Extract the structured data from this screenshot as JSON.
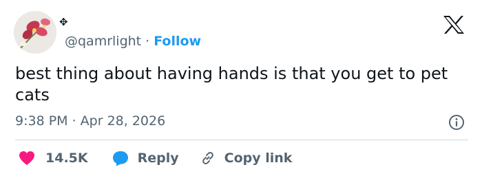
{
  "header": {
    "name_glyph": "✥",
    "handle": "@qamrlight",
    "separator": "·",
    "follow_label": "Follow"
  },
  "tweet": {
    "text": "best thing about having hands is that you get to pet cats",
    "timestamp": "9:38 PM · Apr 28, 2026"
  },
  "actions": {
    "likes_count": "14.5K",
    "reply_label": "Reply",
    "copy_label": "Copy link"
  },
  "icons": {
    "logo": "x-logo-icon",
    "info": "info-icon",
    "like": "heart-icon",
    "reply": "speech-bubble-icon",
    "copy": "link-icon"
  },
  "colors": {
    "accent": "#1d9bf0",
    "heart": "#f91880",
    "muted_text": "#536471",
    "divider": "#cfd9de"
  }
}
